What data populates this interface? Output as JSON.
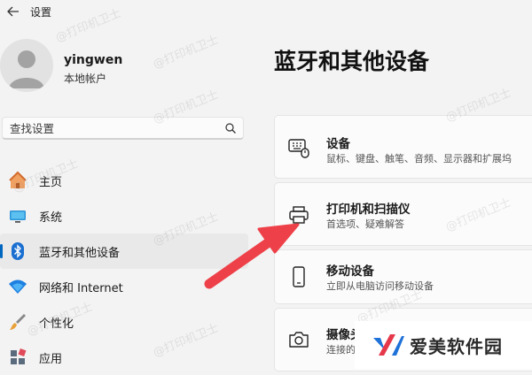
{
  "window": {
    "title": "设置"
  },
  "profile": {
    "name": "yingwen",
    "account_type": "本地帐户"
  },
  "search": {
    "placeholder": "查找设置"
  },
  "nav": {
    "items": [
      {
        "label": "主页",
        "icon": "home-icon"
      },
      {
        "label": "系统",
        "icon": "system-icon"
      },
      {
        "label": "蓝牙和其他设备",
        "icon": "bluetooth-icon",
        "active": true
      },
      {
        "label": "网络和 Internet",
        "icon": "wifi-icon"
      },
      {
        "label": "个性化",
        "icon": "brush-icon"
      },
      {
        "label": "应用",
        "icon": "apps-icon"
      }
    ]
  },
  "main": {
    "title": "蓝牙和其他设备",
    "cards": [
      {
        "title": "设备",
        "subtitle": "鼠标、键盘、触笔、音频、显示器和扩展坞",
        "icon": "devices-icon"
      },
      {
        "title": "打印机和扫描仪",
        "subtitle": "首选项、疑难解答",
        "icon": "printer-icon"
      },
      {
        "title": "移动设备",
        "subtitle": "立即从电脑访问移动设备",
        "icon": "mobile-icon"
      },
      {
        "title": "摄像头",
        "subtitle": "连接的摄像头",
        "icon": "camera-icon"
      }
    ]
  },
  "watermark": "@打印机卫士",
  "brand": {
    "name": "爱美软件园"
  },
  "colors": {
    "accent": "#0067c0",
    "arrow": "#ee4048",
    "background": "#f3f3f3"
  }
}
